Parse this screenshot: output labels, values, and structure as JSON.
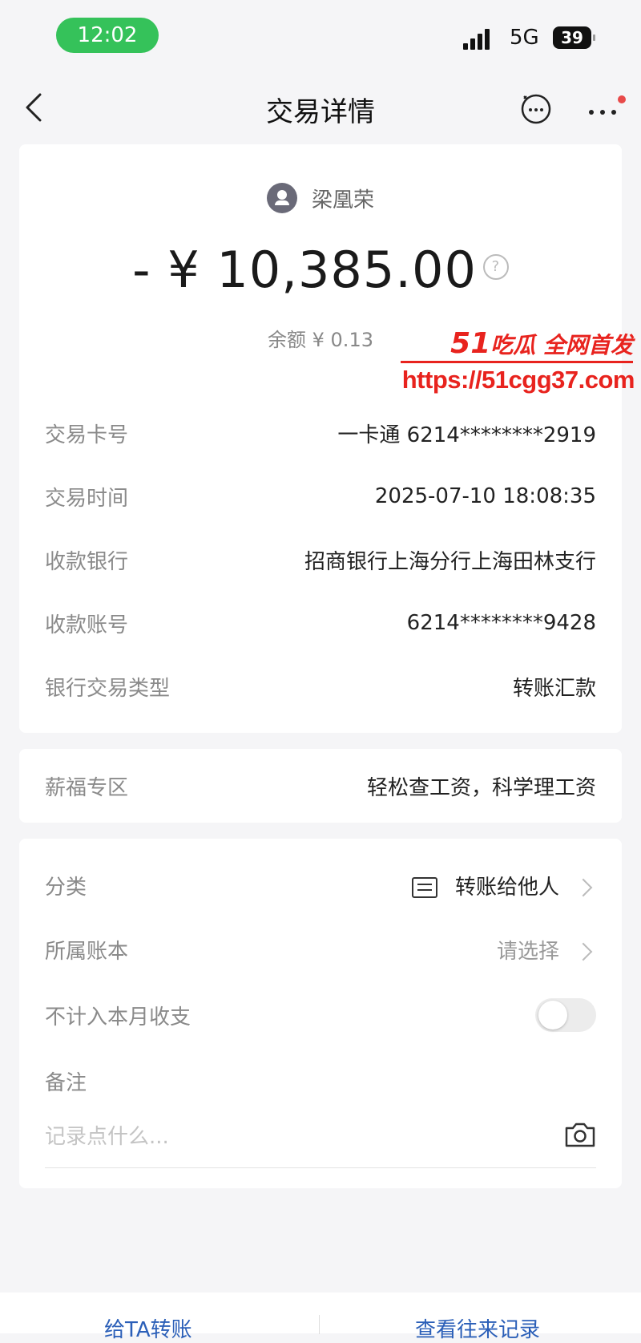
{
  "status_bar": {
    "time": "12:02",
    "network": "5G",
    "battery": "39"
  },
  "nav": {
    "title": "交易详情"
  },
  "header": {
    "payee_name": "梁凰荣",
    "amount": "- ¥ 10,385.00",
    "balance": "余额 ¥ 0.13"
  },
  "watermark": {
    "tagline_num": "51",
    "tagline_text": "吃瓜 全网首发",
    "url": "https://51cgg37.com"
  },
  "details": [
    {
      "label": "交易卡号",
      "value": "一卡通 6214********2919"
    },
    {
      "label": "交易时间",
      "value": "2025-07-10 18:08:35"
    },
    {
      "label": "收款银行",
      "value": "招商银行上海分行上海田林支行"
    },
    {
      "label": "收款账号",
      "value": "6214********9428"
    },
    {
      "label": "银行交易类型",
      "value": "转账汇款"
    }
  ],
  "salary": {
    "label": "薪福专区",
    "value": "轻松查工资，科学理工资"
  },
  "settings": {
    "category_label": "分类",
    "category_value": "转账给他人",
    "book_label": "所属账本",
    "book_value": "请选择",
    "exclude_label": "不计入本月收支",
    "exclude_on": false,
    "memo_label": "备注",
    "memo_placeholder": "记录点什么..."
  },
  "bottom": {
    "transfer": "给TA转账",
    "history": "查看往来记录"
  },
  "colors": {
    "status_green": "#35c25a",
    "watermark_red": "#e8231e",
    "link_blue": "#2b5fb8"
  }
}
